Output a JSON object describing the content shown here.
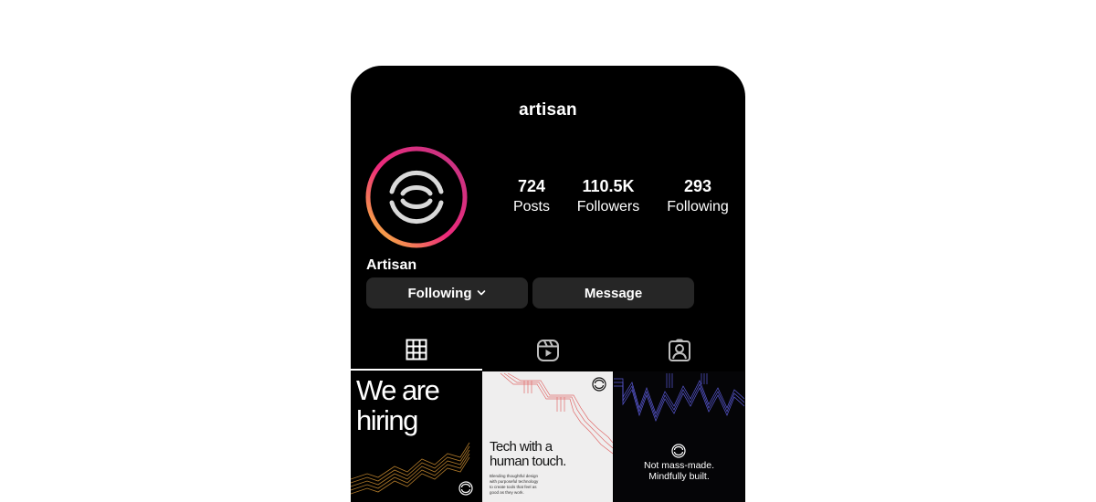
{
  "profile": {
    "username": "artisan",
    "display_name": "Artisan",
    "avatar_icon": "artisan-logo-icon"
  },
  "stats": {
    "posts_count": "724",
    "posts_label": "Posts",
    "followers_count": "110.5K",
    "followers_label": "Followers",
    "following_count": "293",
    "following_label": "Following"
  },
  "actions": {
    "following_label": "Following",
    "message_label": "Message"
  },
  "tabs": [
    {
      "icon": "grid-icon",
      "active": true
    },
    {
      "icon": "reels-icon",
      "active": false
    },
    {
      "icon": "tagged-icon",
      "active": false
    }
  ],
  "posts": [
    {
      "line1": "We are",
      "line2": "hiring"
    },
    {
      "headline1": "Tech with a",
      "headline2": "human touch.",
      "body1": "Blending thoughtful design",
      "body2": "with purposeful technology",
      "body3": "to create tools that feel as",
      "body4": "good as they work."
    },
    {
      "line1": "Not mass-made.",
      "line2": "Mindfully built."
    }
  ],
  "colors": {
    "background": "#000000",
    "button": "#262626",
    "ring_start": "#f9ce34",
    "ring_mid": "#ee2a7b",
    "ring_end": "#6228d7",
    "tile1_lines": "#b07a2a",
    "tile2_lines": "#e06a6a",
    "tile3_lines": "#5a5ad6"
  }
}
